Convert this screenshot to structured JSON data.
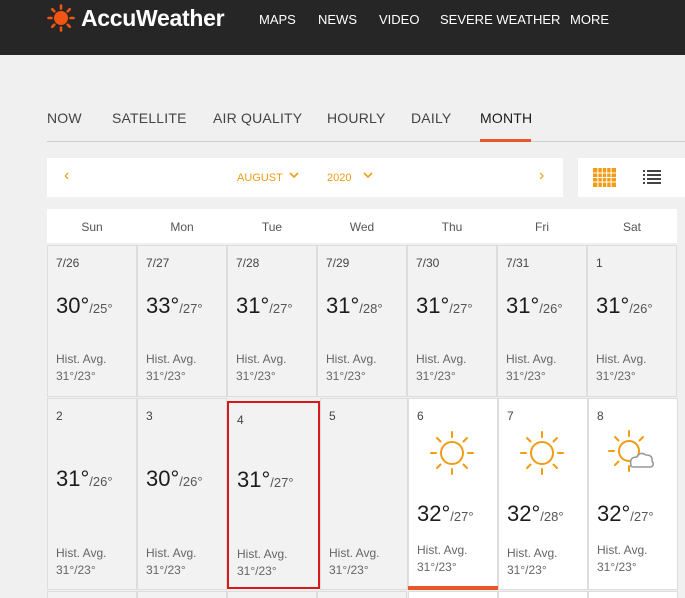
{
  "header": {
    "brand": "AccuWeather",
    "nav": [
      "MAPS",
      "NEWS",
      "VIDEO",
      "SEVERE WEATHER",
      "MORE"
    ]
  },
  "tabs": [
    "NOW",
    "SATELLITE",
    "AIR QUALITY",
    "HOURLY",
    "DAILY",
    "MONTH"
  ],
  "active_tab": "MONTH",
  "selector": {
    "prev_arrow": "‹",
    "month": "AUGUST",
    "year": "2020",
    "next_arrow": "›"
  },
  "weekdays": [
    "Sun",
    "Mon",
    "Tue",
    "Wed",
    "Thu",
    "Fri",
    "Sat"
  ],
  "hist_label": "Hist. Avg.",
  "weeks": [
    [
      {
        "date": "7/26",
        "high": "30°",
        "low": "/25°",
        "hist": "31°/23°"
      },
      {
        "date": "7/27",
        "high": "33°",
        "low": "/27°",
        "hist": "31°/23°"
      },
      {
        "date": "7/28",
        "high": "31°",
        "low": "/27°",
        "hist": "31°/23°"
      },
      {
        "date": "7/29",
        "high": "31°",
        "low": "/28°",
        "hist": "31°/23°"
      },
      {
        "date": "7/30",
        "high": "31°",
        "low": "/27°",
        "hist": "31°/23°"
      },
      {
        "date": "7/31",
        "high": "31°",
        "low": "/26°",
        "hist": "31°/23°"
      },
      {
        "date": "1",
        "high": "31°",
        "low": "/26°",
        "hist": "31°/23°"
      }
    ],
    [
      {
        "date": "2",
        "high": "31°",
        "low": "/26°",
        "hist": "31°/23°"
      },
      {
        "date": "3",
        "high": "30°",
        "low": "/26°",
        "hist": "31°/23°"
      },
      {
        "date": "4",
        "high": "31°",
        "low": "/27°",
        "hist": "31°/23°",
        "selected": true
      },
      {
        "date": "5",
        "high": "",
        "low": "",
        "hist": "31°/23°"
      },
      {
        "date": "6",
        "high": "32°",
        "low": "/27°",
        "hist": "31°/23°",
        "icon": "sun-icon",
        "today": true
      },
      {
        "date": "7",
        "high": "32°",
        "low": "/28°",
        "hist": "31°/23°",
        "icon": "sun-icon"
      },
      {
        "date": "8",
        "high": "32°",
        "low": "/27°",
        "hist": "31°/23°",
        "icon": "partly-cloudy-icon"
      }
    ]
  ],
  "colors": {
    "accent": "#f29b15",
    "brand_orange": "#e8572a",
    "selected_border": "#d7191c",
    "topbar": "#262626"
  }
}
